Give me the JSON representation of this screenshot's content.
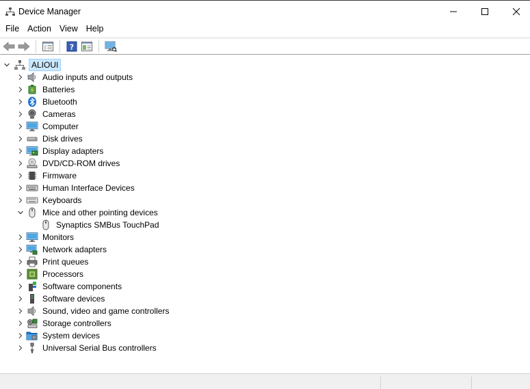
{
  "window": {
    "title": "Device Manager"
  },
  "menu": {
    "file": "File",
    "action": "Action",
    "view": "View",
    "help": "Help"
  },
  "tree": {
    "root": "ALIOUI",
    "categories": [
      {
        "label": "Audio inputs and outputs",
        "icon": "speaker-icon",
        "expanded": false
      },
      {
        "label": "Batteries",
        "icon": "battery-icon",
        "expanded": false
      },
      {
        "label": "Bluetooth",
        "icon": "bluetooth-icon",
        "expanded": false
      },
      {
        "label": "Cameras",
        "icon": "camera-icon",
        "expanded": false
      },
      {
        "label": "Computer",
        "icon": "monitor-icon",
        "expanded": false
      },
      {
        "label": "Disk drives",
        "icon": "disk-drive-icon",
        "expanded": false
      },
      {
        "label": "Display adapters",
        "icon": "display-adapter-icon",
        "expanded": false
      },
      {
        "label": "DVD/CD-ROM drives",
        "icon": "dvd-drive-icon",
        "expanded": false
      },
      {
        "label": "Firmware",
        "icon": "chip-icon",
        "expanded": false
      },
      {
        "label": "Human Interface Devices",
        "icon": "hid-icon",
        "expanded": false
      },
      {
        "label": "Keyboards",
        "icon": "keyboard-icon",
        "expanded": false
      },
      {
        "label": "Mice and other pointing devices",
        "icon": "mouse-icon",
        "expanded": true,
        "children": [
          "Synaptics SMBus TouchPad"
        ]
      },
      {
        "label": "Monitors",
        "icon": "monitor-icon",
        "expanded": false
      },
      {
        "label": "Network adapters",
        "icon": "network-icon",
        "expanded": false
      },
      {
        "label": "Print queues",
        "icon": "printer-icon",
        "expanded": false
      },
      {
        "label": "Processors",
        "icon": "processor-icon",
        "expanded": false
      },
      {
        "label": "Software components",
        "icon": "software-component-icon",
        "expanded": false
      },
      {
        "label": "Software devices",
        "icon": "software-device-icon",
        "expanded": false
      },
      {
        "label": "Sound, video and game controllers",
        "icon": "speaker-icon",
        "expanded": false
      },
      {
        "label": "Storage controllers",
        "icon": "storage-controller-icon",
        "expanded": false
      },
      {
        "label": "System devices",
        "icon": "system-folder-icon",
        "expanded": false
      },
      {
        "label": "Universal Serial Bus controllers",
        "icon": "usb-icon",
        "expanded": false
      }
    ]
  },
  "colors": {
    "selection_bg": "#cce8ff",
    "selection_border": "#99d1ff",
    "window_border": "#3a3a3a"
  }
}
